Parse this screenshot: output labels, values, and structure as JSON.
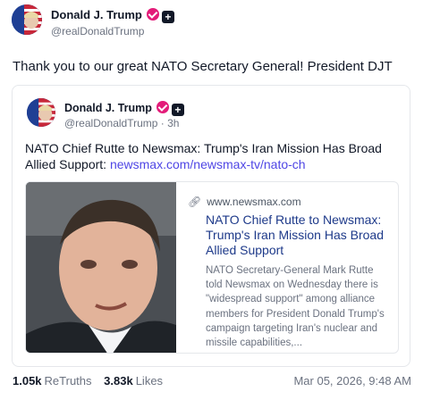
{
  "post": {
    "author": {
      "name": "Donald J. Trump",
      "handle": "@realDonaldTrump",
      "avatar_icon": "flag-avatar",
      "verified_color": "#e31c79"
    },
    "text": "Thank you to our great NATO Secretary General! President DJT"
  },
  "quote": {
    "author": {
      "name": "Donald J. Trump",
      "handle_time": "@realDonaldTrump · 3h"
    },
    "text": "NATO Chief Rutte to Newsmax: Trump's Iran Mission Has Broad Allied Support: ",
    "link": "newsmax.com/newsmax-tv/nato-ch"
  },
  "preview": {
    "domain": "www.newsmax.com",
    "title": "NATO Chief Rutte to Newsmax: Trump's Iran Mission Has Broad Allied Support",
    "description": "NATO Secretary-General Mark Rutte told Newsmax on Wednesday there is \"widespread support\" among alliance members for President Donald Trump's campaign targeting Iran's nuclear and missile capabilities,..."
  },
  "stats": {
    "retruths_count": "1.05k",
    "retruths_label": "ReTruths",
    "likes_count": "3.83k",
    "likes_label": "Likes",
    "timestamp": "Mar 05, 2026, 9:48 AM"
  },
  "colors": {
    "link": "#4f46e5",
    "preview_title": "#1e3a8a",
    "muted": "#6b7280"
  }
}
